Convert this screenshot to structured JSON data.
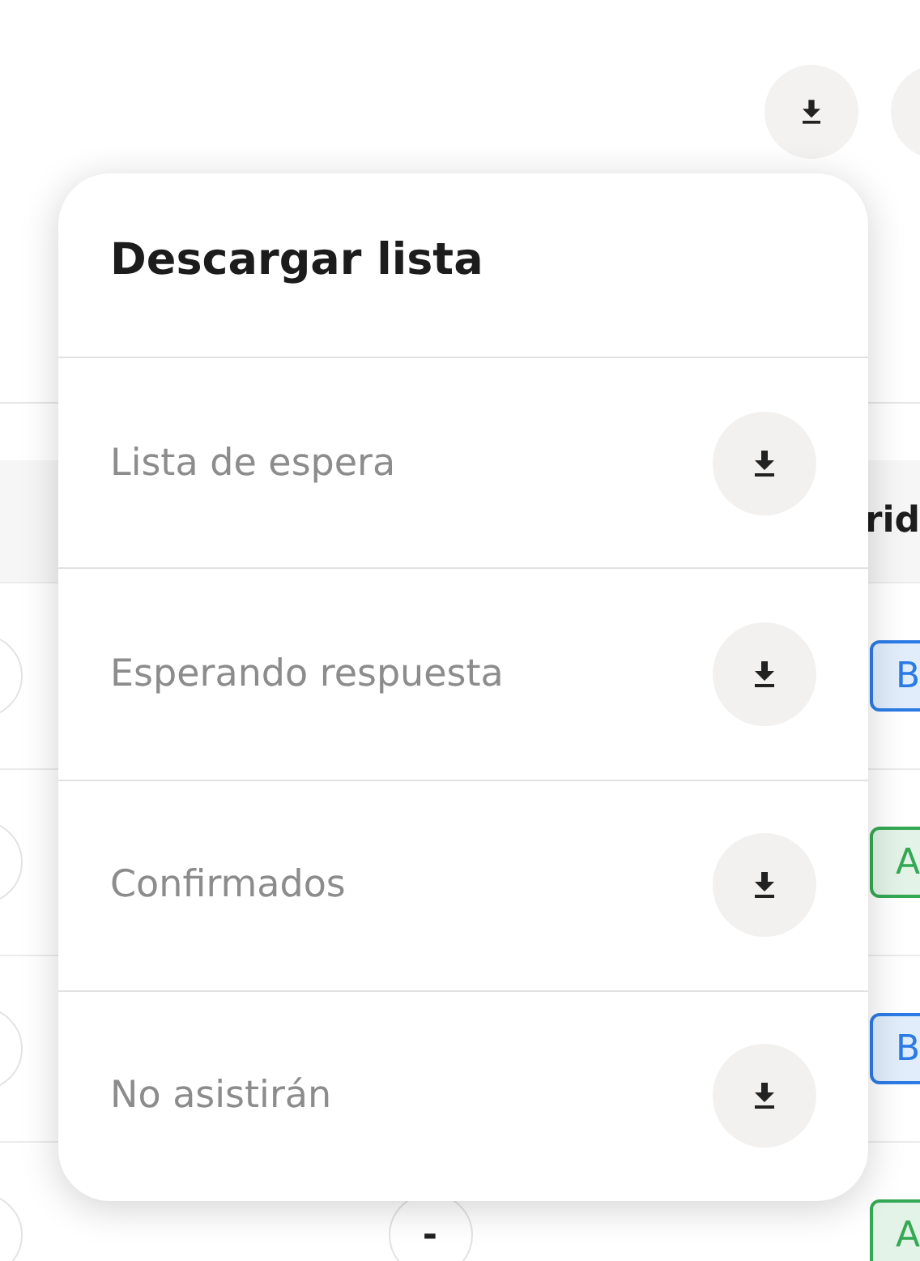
{
  "toolbar": {
    "buttons": [
      {
        "kind": "download"
      },
      {
        "kind": "blank"
      }
    ]
  },
  "table": {
    "header": {
      "column_text": "rid"
    },
    "rows": [
      {
        "badge": {
          "text": "B",
          "color": "#2c7be5"
        }
      },
      {
        "badge": {
          "text": "A",
          "color": "#34a853"
        }
      },
      {
        "badge": {
          "text": "B",
          "color": "#2c7be5"
        }
      },
      {
        "middle": "-",
        "badge": {
          "text": "A",
          "color": "#34a853"
        }
      }
    ]
  },
  "popup": {
    "title": "Descargar lista",
    "items": [
      {
        "label": "Lista de espera"
      },
      {
        "label": "Esperando respuesta"
      },
      {
        "label": "Confirmados"
      },
      {
        "label": "No asistirán"
      }
    ]
  }
}
